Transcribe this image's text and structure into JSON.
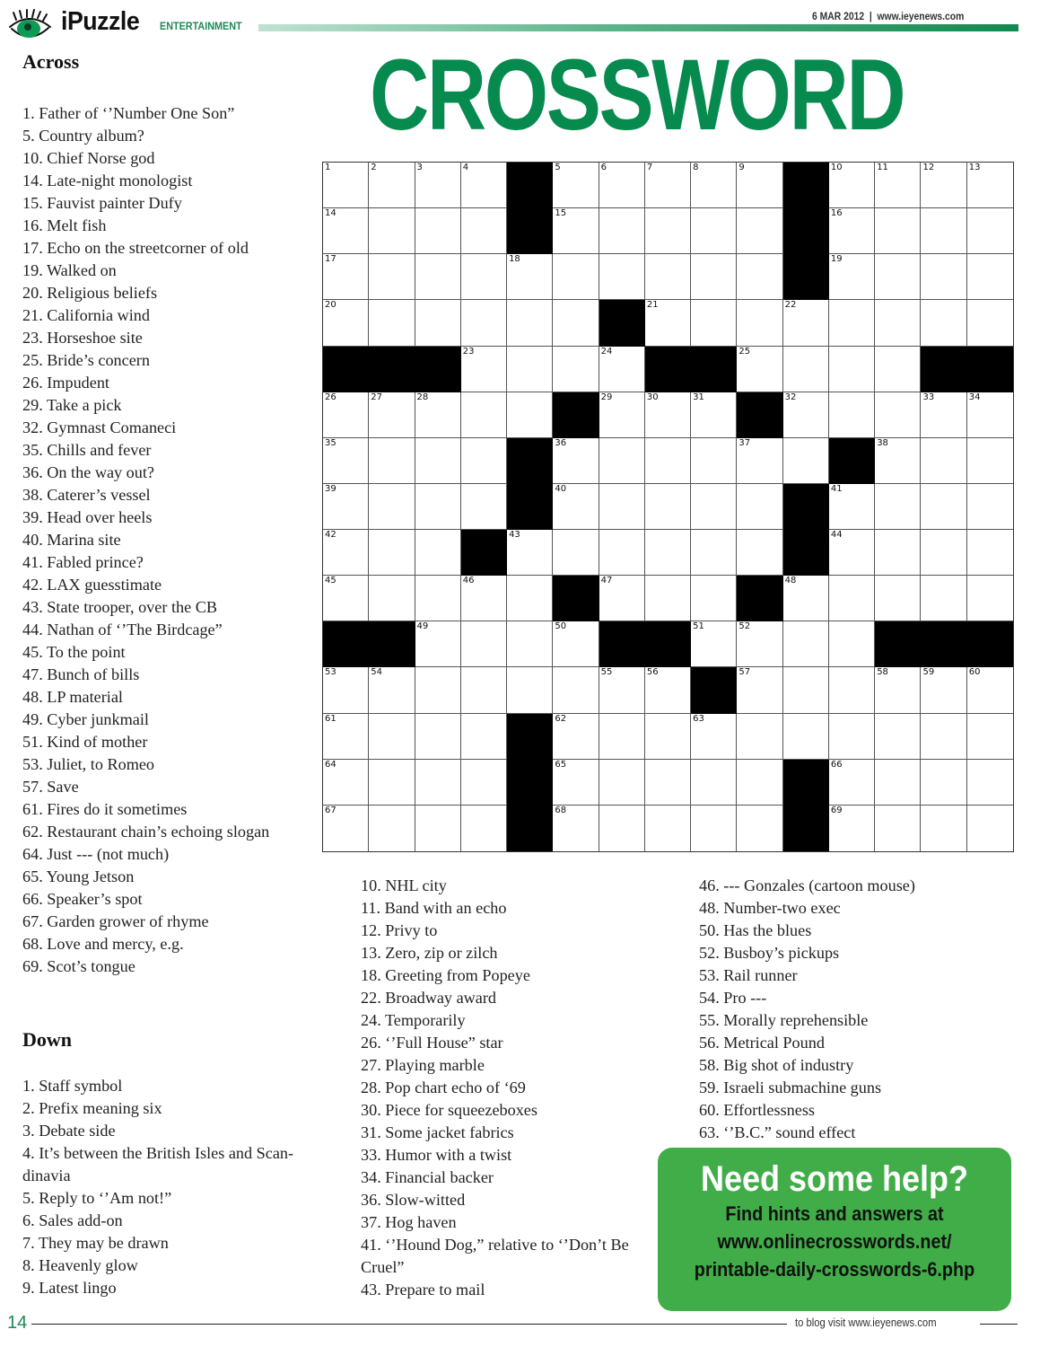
{
  "header": {
    "brand": "iPuzzle",
    "section": "ENTERTAINMENT",
    "date": "6 MAR 2012",
    "separator": "|",
    "website": "www.ieyenews.com",
    "title": "CROSSWORD",
    "accent_color": "#068a4e"
  },
  "across": {
    "heading": "Across",
    "clues": [
      "1. Father of ‘’Number One Son”",
      "5. Country album?",
      "10. Chief Norse god",
      "14. Late-night monologist",
      "15. Fauvist painter Dufy",
      "16. Melt fish",
      "17. Echo on the streetcorner of old",
      "19. Walked on",
      "20. Religious beliefs",
      "21. California wind",
      "23. Horseshoe site",
      "25. Bride’s concern",
      "26. Impudent",
      "29. Take a pick",
      "32. Gymnast Comaneci",
      "35. Chills and fever",
      "36. On the way out?",
      "38. Caterer’s vessel",
      "39. Head over heels",
      "40. Marina site",
      "41. Fabled prince?",
      "42. LAX guesstimate",
      "43. State trooper, over the CB",
      "44. Nathan of ‘’The Birdcage”",
      "45. To the point",
      "47. Bunch of bills",
      "48. LP material",
      "49. Cyber junkmail",
      "51. Kind of mother",
      "53. Juliet, to Romeo",
      "57. Save",
      "61. Fires do it sometimes",
      "62. Restaurant chain’s echoing slogan",
      "64. Just --- (not much)",
      "65. Young Jetson",
      "66. Speaker’s spot",
      "67. Garden grower of rhyme",
      "68. Love and mercy, e.g.",
      "69. Scot’s tongue"
    ]
  },
  "down": {
    "heading": "Down",
    "col1": [
      "1. Staff symbol",
      "2. Prefix meaning six",
      "3. Debate side",
      "4. It’s between the British Isles and Scan-dinavia",
      "5. Reply to ‘’Am not!”",
      "6. Sales add-on",
      "7. They may be drawn",
      "8. Heavenly glow",
      "9. Latest lingo"
    ],
    "col2": [
      "10. NHL city",
      "11. Band with an echo",
      "12. Privy to",
      "13. Zero, zip or zilch",
      "18. Greeting from Popeye",
      "22. Broadway award",
      "24. Temporarily",
      "26. ‘’Full House” star",
      "27. Playing marble",
      "28. Pop chart echo of ‘69",
      "30. Piece for squeezeboxes",
      "31. Some jacket fabrics",
      "33. Humor with a twist",
      "34. Financial backer",
      "36. Slow-witted",
      "37. Hog haven",
      "41. ‘’Hound Dog,” relative to ‘’Don’t Be Cruel”",
      "43. Prepare to mail"
    ],
    "col3": [
      "46. --- Gonzales (cartoon mouse)",
      "48. Number-two exec",
      "50. Has the blues",
      "52. Busboy’s pickups",
      "53. Rail runner",
      "54. Pro ---",
      "55. Morally reprehensible",
      "56. Metrical Pound",
      "58. Big shot of industry",
      "59. Israeli submachine guns",
      "60. Effortlessness",
      "63. ‘’B.C.” sound effect"
    ]
  },
  "grid": {
    "rows": [
      "....#.....#....",
      "....#.....#....",
      "..........#....",
      "......#........",
      "###....##....##",
      ".....#...#.....",
      "....#......#...",
      "....#.....#....",
      "...#......#....",
      ".....#...#.....",
      "##....##....###",
      "........#......",
      "....#..........",
      "....#.....#....",
      "....#.....#...."
    ]
  },
  "help_box": {
    "title": "Need some help?",
    "line1": "Find hints and answers at",
    "line2": "www.onlinecrosswords.net/",
    "line3": "printable-daily-crosswords-6.php",
    "color": "#41ad49"
  },
  "footer": {
    "page_number": "14",
    "blog_text": "to blog visit www.ieyenews.com"
  }
}
